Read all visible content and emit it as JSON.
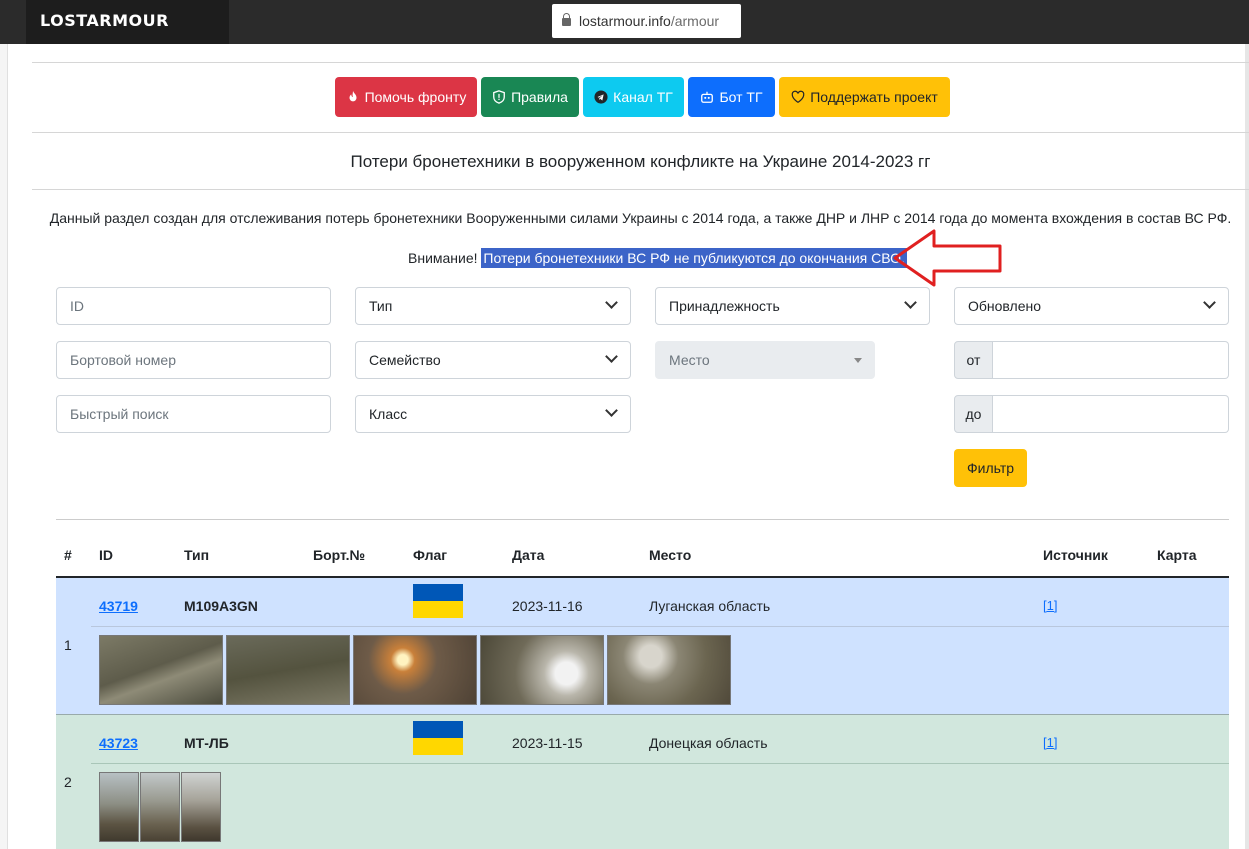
{
  "browser": {
    "logo": "LOSTARMOUR",
    "url_host": "lostarmour.info",
    "url_path": "/armour"
  },
  "nav": {
    "help_front": "Помочь фронту",
    "rules": "Правила",
    "tg_channel": "Канал ТГ",
    "tg_bot": "Бот ТГ",
    "support": "Поддержать проект"
  },
  "page": {
    "title": "Потери бронетехники в вооруженном конфликте на Украине 2014-2023 гг",
    "description": "Данный раздел создан для отслеживания потерь бронетехники Вооруженными силами Украины с 2014 года, а также ДНР и ЛНР с 2014 года до момента вхождения в состав ВС РФ.",
    "warning_label": "Внимание!",
    "warning_text": "Потери бронетехники ВС РФ не публикуются до окончания СВО."
  },
  "filters": {
    "id_placeholder": "ID",
    "board_placeholder": "Бортовой номер",
    "quick_placeholder": "Быстрый поиск",
    "type": "Тип",
    "family": "Семейство",
    "class": "Класс",
    "affiliation": "Принадлежность",
    "place": "Место",
    "updated": "Обновлено",
    "from": "от",
    "to": "до",
    "filter_button": "Фильтр"
  },
  "table": {
    "headers": [
      "#",
      "ID",
      "Тип",
      "Борт.№",
      "Флаг",
      "Дата",
      "Место",
      "Источник",
      "Карта"
    ],
    "rows": [
      {
        "num": "1",
        "id": "43719",
        "type": "M109A3GN",
        "board": "",
        "date": "2023-11-16",
        "place": "Луганская область",
        "source": "[1]",
        "map": ""
      },
      {
        "num": "2",
        "id": "43723",
        "type": "МТ-ЛБ",
        "board": "",
        "date": "2023-11-15",
        "place": "Донецкая область",
        "source": "[1]",
        "map": ""
      }
    ]
  },
  "colors": {
    "row1_bg": "#cfe2ff",
    "row2_bg": "#d1e7dd",
    "flag_blue": "#0057b7",
    "flag_yellow": "#ffd700",
    "arrow": "#e02020"
  }
}
